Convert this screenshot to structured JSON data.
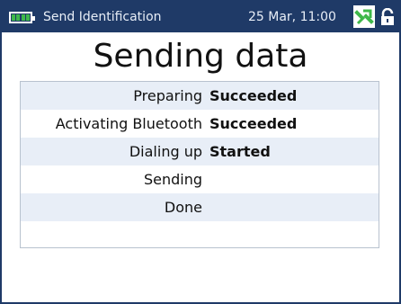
{
  "header": {
    "title": "Send Identification",
    "datetime": "25 Mar, 11:00",
    "battery_icon": "battery-icon",
    "signal_icon": "satellite-signal-icon",
    "lock_icon": "lock-icon",
    "accent_color": "#1f3a67"
  },
  "main": {
    "heading": "Sending data",
    "steps": [
      {
        "label": "Preparing",
        "status": "Succeeded"
      },
      {
        "label": "Activating Bluetooth",
        "status": "Succeeded"
      },
      {
        "label": "Dialing up",
        "status": "Started"
      },
      {
        "label": "Sending",
        "status": ""
      },
      {
        "label": "Done",
        "status": ""
      }
    ]
  }
}
